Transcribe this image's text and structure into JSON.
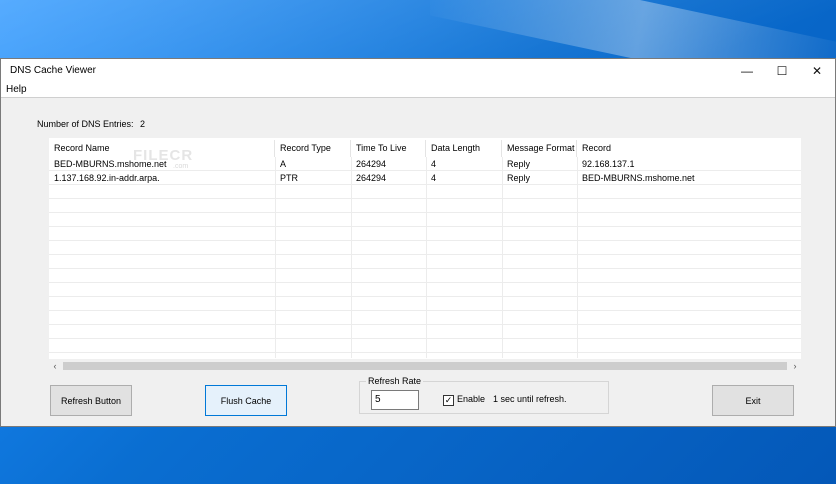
{
  "window": {
    "title": "DNS Cache Viewer",
    "minimize_icon": "minimize-icon",
    "maximize_icon": "maximize-icon",
    "close_icon": "close-icon",
    "minimize_glyph": "—",
    "maximize_glyph": "☐",
    "close_glyph": "✕"
  },
  "menu": {
    "help": "Help"
  },
  "summary": {
    "label": "Number of DNS Entries:",
    "count": "2"
  },
  "table": {
    "columns": [
      "Record Name",
      "Record Type",
      "Time To Live",
      "Data Length",
      "Message Format",
      "Record"
    ],
    "rows": [
      [
        "BED-MBURNS.mshome.net",
        "A",
        "264294",
        "4",
        "Reply",
        "92.168.137.1"
      ],
      [
        "1.137.168.92.in-addr.arpa.",
        "PTR",
        "264294",
        "4",
        "Reply",
        "BED-MBURNS.mshome.net"
      ]
    ]
  },
  "scrollbar": {
    "left_glyph": "‹",
    "right_glyph": "›"
  },
  "watermark": {
    "text": "FILECR",
    "sub": ".com"
  },
  "buttons": {
    "refresh": "Refresh Button",
    "flush": "Flush Cache",
    "exit": "Exit"
  },
  "refresh_group": {
    "title": "Refresh Rate",
    "rate_value": "5",
    "enable_label": "Enable",
    "enable_checked": true,
    "check_glyph": "✓",
    "status": "1 sec until refresh."
  },
  "colors": {
    "focus_border": "#0078d7",
    "desktop": "#0a6ed1"
  }
}
